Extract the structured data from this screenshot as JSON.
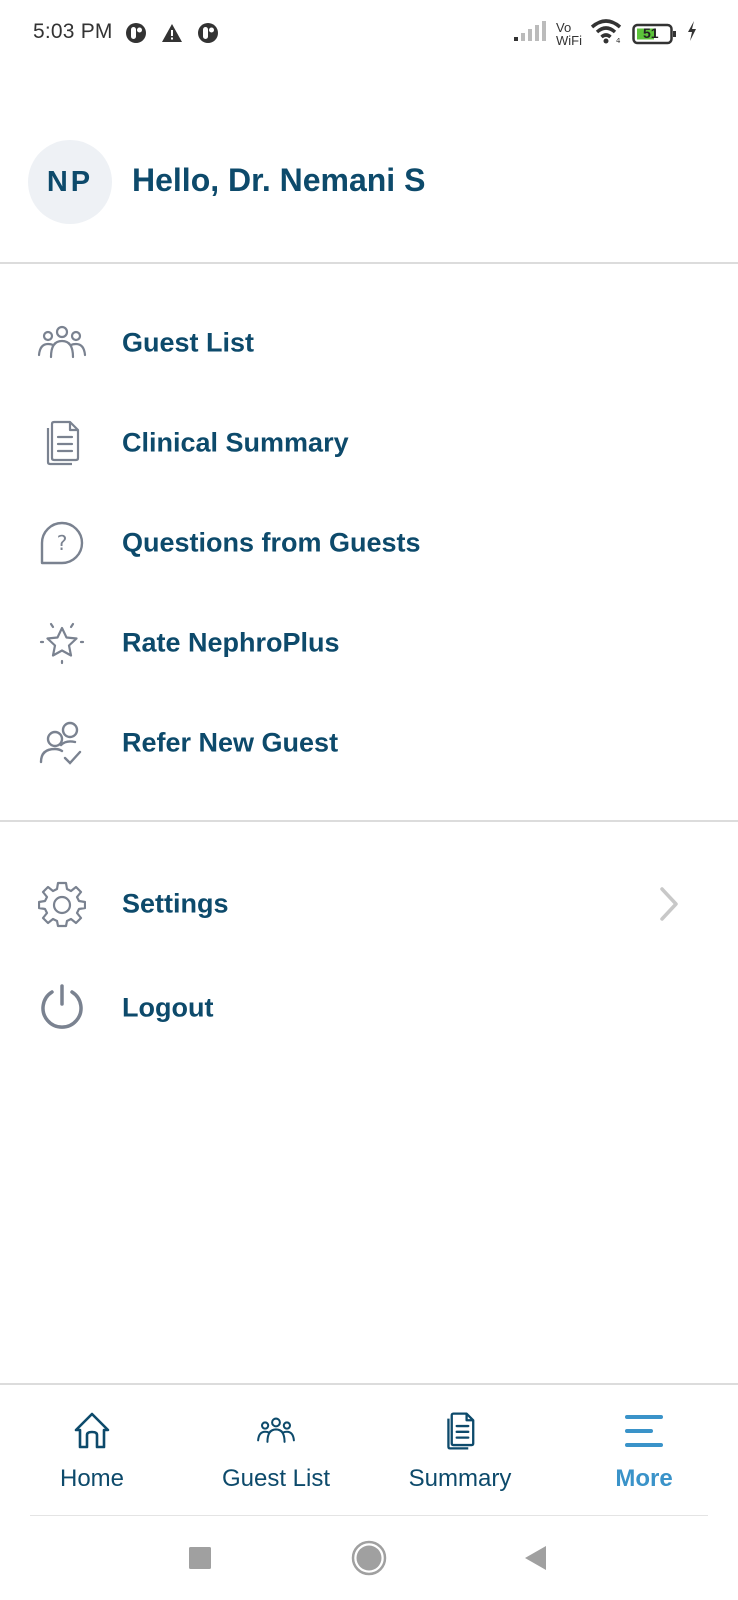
{
  "status_bar": {
    "time": "5:03 PM",
    "left_icons": [
      "app-notification-icon",
      "warning-icon",
      "app-notification-icon"
    ],
    "right_icons": [
      "signal-icon",
      "vowifi-icon",
      "wifi-icon",
      "battery-icon",
      "charging-icon"
    ],
    "vowifi_top": "Vo",
    "vowifi_bottom": "WiFi",
    "battery_level": "51",
    "battery_color": "#5cc43a"
  },
  "profile": {
    "initials": "NP",
    "greeting": "Hello, Dr. Nemani S"
  },
  "menu": {
    "primary": [
      {
        "label": "Guest List",
        "icon": "users-icon"
      },
      {
        "label": "Clinical Summary",
        "icon": "document-icon"
      },
      {
        "label": "Questions from Guests",
        "icon": "question-bubble-icon"
      },
      {
        "label": "Rate NephroPlus",
        "icon": "star-icon"
      },
      {
        "label": "Refer New Guest",
        "icon": "refer-user-icon"
      }
    ],
    "secondary": [
      {
        "label": "Settings",
        "icon": "gear-icon",
        "has_chevron": true
      },
      {
        "label": "Logout",
        "icon": "power-icon",
        "has_chevron": false
      }
    ]
  },
  "bottom_nav": {
    "items": [
      {
        "label": "Home",
        "icon": "home-icon",
        "active": false
      },
      {
        "label": "Guest List",
        "icon": "users-icon",
        "active": false
      },
      {
        "label": "Summary",
        "icon": "document-icon",
        "active": false
      },
      {
        "label": "More",
        "icon": "menu-icon",
        "active": true
      }
    ],
    "active_color": "#3a93c9",
    "text_color": "#0d4a6b"
  },
  "system_nav": {
    "buttons": [
      "recents-button",
      "home-button",
      "back-button"
    ]
  },
  "colors": {
    "brand_text": "#0d4a6b",
    "icon_gray": "#7a8290",
    "divider": "#dcdcdc",
    "avatar_bg": "#eef1f5"
  }
}
